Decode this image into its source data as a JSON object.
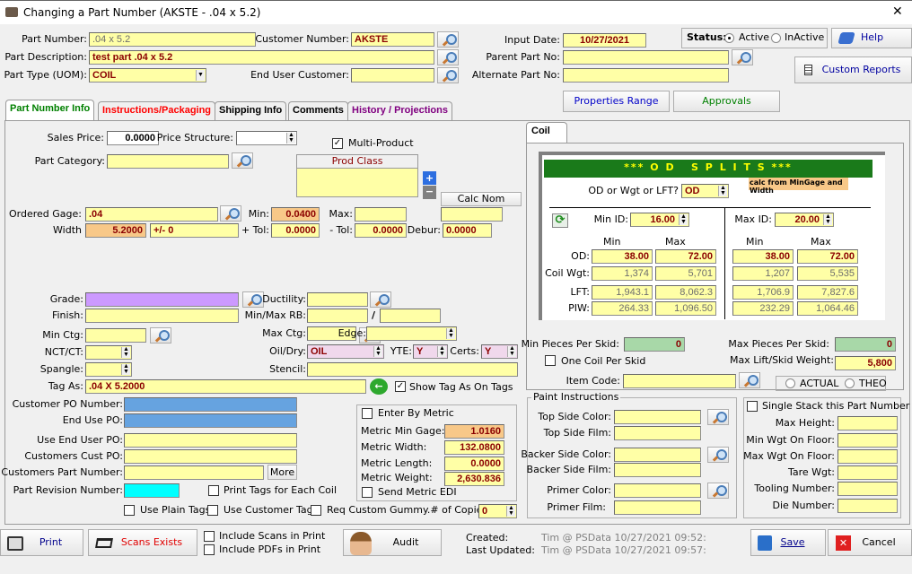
{
  "window": {
    "title": "Changing a Part Number  (AKSTE - .04 x 5.2)",
    "close": "✕"
  },
  "header": {
    "part_number_label": "Part Number:",
    "part_number": ".04 x 5.2",
    "customer_number_label": "Customer Number:",
    "customer_number": "AKSTE",
    "part_description_label": "Part Description:",
    "part_description": "test part .04 x 5.2",
    "part_type_label": "Part Type (UOM):",
    "part_type": "COIL",
    "end_user_customer_label": "End User Customer:",
    "end_user_customer": "",
    "input_date_label": "Input Date:",
    "input_date": "10/27/2021",
    "parent_part_label": "Parent Part No:",
    "alternate_part_label": "Alternate Part No:",
    "status_label": "Status:",
    "status_options": [
      "Active",
      "InActive"
    ],
    "status_selected": "Active",
    "help": "Help",
    "custom_reports": "Custom Reports",
    "properties_range": "Properties Range",
    "approvals": "Approvals"
  },
  "tabs": [
    {
      "label": "Part Number Info",
      "color": "#008000"
    },
    {
      "label": "Instructions/Packaging",
      "color": "#ff0000"
    },
    {
      "label": "Shipping Info",
      "color": "#000000"
    },
    {
      "label": "Comments",
      "color": "#000000"
    },
    {
      "label": "History / Projections",
      "color": "#800080"
    }
  ],
  "main": {
    "sales_price_label": "Sales Price:",
    "sales_price": "0.0000",
    "price_structure_label": "Price Structure:",
    "multi_product": "Multi-Product",
    "prod_class": "Prod Class",
    "part_category_label": "Part Category:",
    "calc_nom": "Calc Nom",
    "ordered_gage_label": "Ordered Gage:",
    "ordered_gage": ".04",
    "min_label": "Min:",
    "min": "0.0400",
    "max_label": "Max:",
    "width_label": "Width",
    "width": "5.2000",
    "width_tol": "+/- 0",
    "plus_tol_label": "+ Tol:",
    "plus_tol": "0.0000",
    "minus_tol_label": "- Tol:",
    "minus_tol": "0.0000",
    "debur_label": "Debur:",
    "debur": "0.0000",
    "grade_label": "Grade:",
    "ductility_label": "Ductility:",
    "finish_label": "Finish:",
    "minmax_rb_label": "Min/Max RB:",
    "slash": "/",
    "min_ctg_label": "Min Ctg:",
    "max_ctg_label": "Max Ctg:",
    "edge_label": "Edge:",
    "nct_label": "NCT/CT:",
    "oil_dry_label": "Oil/Dry:",
    "oil_dry": "OIL",
    "yte_label": "YTE:",
    "yte": "Y",
    "certs_label": "Certs:",
    "certs": "Y",
    "spangle_label": "Spangle:",
    "stencil_label": "Stencil:",
    "tag_as_label": "Tag As:",
    "tag_as": ".04 X  5.2000",
    "show_tag": "Show Tag As On Tags",
    "customer_po_label": "Customer PO Number:",
    "end_use_po_label": "End Use PO:",
    "use_end_user_po_label": "Use End User PO:",
    "customers_cust_po_label": "Customers Cust PO:",
    "customers_part_label": "Customers Part Number:",
    "more": "More",
    "part_revision_label": "Part Revision Number:",
    "print_tags_each": "Print Tags for Each Coil",
    "use_plain_tags": "Use Plain Tags",
    "use_customer_tags": "Use Customer Tags",
    "req_custom_gummy": "Req Custom Gummy.",
    "copies_label": "# of Copies:",
    "copies": "0",
    "enter_by_metric": "Enter By Metric",
    "metric_min_gage_label": "Metric Min Gage:",
    "metric_min_gage": "1.0160",
    "metric_width_label": "Metric Width:",
    "metric_width": "132.0800",
    "metric_length_label": "Metric Length:",
    "metric_length": "0.0000",
    "metric_weight_label": "Metric Weight:",
    "metric_weight": "2,630.836",
    "send_metric_edi": "Send Metric EDI"
  },
  "coil": {
    "tab": "Coil",
    "banner": "*** O D   S P L I T S ***",
    "calc_note": "calc from MinGage and Width",
    "od_wgt_lft_label": "OD or Wgt or LFT?",
    "od_wgt_lft": "OD",
    "min_id_label": "Min ID:",
    "min_id": "16.00",
    "max_id_label": "Max ID:",
    "max_id": "20.00",
    "col_min": "Min",
    "col_max": "Max",
    "rows": [
      {
        "label": "OD:",
        "v": [
          "38.00",
          "72.00",
          "38.00",
          "72.00"
        ]
      },
      {
        "label": "Coil Wgt:",
        "v": [
          "1,374",
          "5,701",
          "1,207",
          "5,535"
        ]
      },
      {
        "label": "LFT:",
        "v": [
          "1,943.1",
          "8,062.3",
          "1,706.9",
          "7,827.6"
        ]
      },
      {
        "label": "PIW:",
        "v": [
          "264.33",
          "1,096.50",
          "232.29",
          "1,064.46"
        ]
      }
    ],
    "min_pieces_label": "Min Pieces Per Skid:",
    "min_pieces": "0",
    "max_pieces_label": "Max Pieces Per Skid:",
    "max_pieces": "0",
    "one_coil": "One Coil Per Skid",
    "max_lift_label": "Max Lift/Skid Weight:",
    "max_lift": "5,800",
    "item_code_label": "Item Code:",
    "actual": "ACTUAL",
    "theo": "THEO"
  },
  "paint": {
    "title": "Paint Instructions",
    "top_color": "Top Side Color:",
    "top_film": "Top Side Film:",
    "backer_color": "Backer Side Color:",
    "backer_film": "Backer Side Film:",
    "primer_color": "Primer Color:",
    "primer_film": "Primer Film:"
  },
  "stack": {
    "single_stack": "Single Stack this Part Number",
    "max_height": "Max Height:",
    "min_wgt": "Min Wgt On Floor:",
    "max_wgt": "Max Wgt On Floor:",
    "tare": "Tare Wgt:",
    "tooling": "Tooling Number:",
    "die": "Die Number:"
  },
  "footer": {
    "print": "Print",
    "scans": "Scans Exists",
    "include_scans": "Include Scans in Print",
    "include_pdfs": "Include PDFs in Print",
    "audit": "Audit",
    "created_label": "Created:",
    "created": "Tim @ PSData 10/27/2021 09:52:",
    "updated_label": "Last Updated:",
    "updated": "Tim @ PSData 10/27/2021 09:57:",
    "save": "Save",
    "cancel": "Cancel"
  }
}
